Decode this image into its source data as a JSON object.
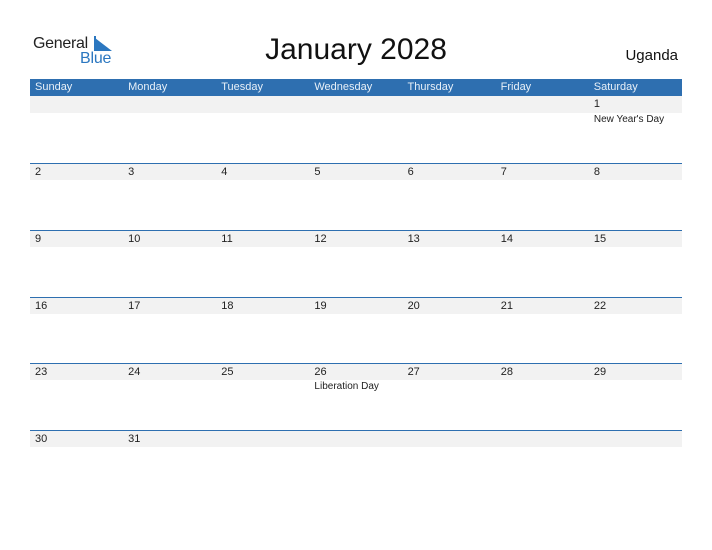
{
  "logo": {
    "line1": "General",
    "line2": "Blue"
  },
  "title": "January 2028",
  "country": "Uganda",
  "colors": {
    "accent": "#2e6fb0",
    "strip": "#f2f2f2",
    "logo_blue": "#2b77c0"
  },
  "weekdays": [
    "Sunday",
    "Monday",
    "Tuesday",
    "Wednesday",
    "Thursday",
    "Friday",
    "Saturday"
  ],
  "weeks": [
    [
      {
        "day": "",
        "event": ""
      },
      {
        "day": "",
        "event": ""
      },
      {
        "day": "",
        "event": ""
      },
      {
        "day": "",
        "event": ""
      },
      {
        "day": "",
        "event": ""
      },
      {
        "day": "",
        "event": ""
      },
      {
        "day": "1",
        "event": "New Year's Day"
      }
    ],
    [
      {
        "day": "2",
        "event": ""
      },
      {
        "day": "3",
        "event": ""
      },
      {
        "day": "4",
        "event": ""
      },
      {
        "day": "5",
        "event": ""
      },
      {
        "day": "6",
        "event": ""
      },
      {
        "day": "7",
        "event": ""
      },
      {
        "day": "8",
        "event": ""
      }
    ],
    [
      {
        "day": "9",
        "event": ""
      },
      {
        "day": "10",
        "event": ""
      },
      {
        "day": "11",
        "event": ""
      },
      {
        "day": "12",
        "event": ""
      },
      {
        "day": "13",
        "event": ""
      },
      {
        "day": "14",
        "event": ""
      },
      {
        "day": "15",
        "event": ""
      }
    ],
    [
      {
        "day": "16",
        "event": ""
      },
      {
        "day": "17",
        "event": ""
      },
      {
        "day": "18",
        "event": ""
      },
      {
        "day": "19",
        "event": ""
      },
      {
        "day": "20",
        "event": ""
      },
      {
        "day": "21",
        "event": ""
      },
      {
        "day": "22",
        "event": ""
      }
    ],
    [
      {
        "day": "23",
        "event": ""
      },
      {
        "day": "24",
        "event": ""
      },
      {
        "day": "25",
        "event": ""
      },
      {
        "day": "26",
        "event": "Liberation Day"
      },
      {
        "day": "27",
        "event": ""
      },
      {
        "day": "28",
        "event": ""
      },
      {
        "day": "29",
        "event": ""
      }
    ],
    [
      {
        "day": "30",
        "event": ""
      },
      {
        "day": "31",
        "event": ""
      },
      {
        "day": "",
        "event": ""
      },
      {
        "day": "",
        "event": ""
      },
      {
        "day": "",
        "event": ""
      },
      {
        "day": "",
        "event": ""
      },
      {
        "day": "",
        "event": ""
      }
    ]
  ]
}
